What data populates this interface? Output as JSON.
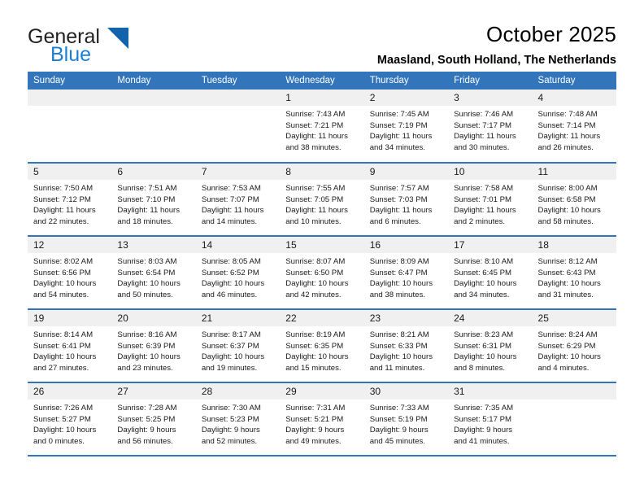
{
  "brand": {
    "name_part1": "General",
    "name_part2": "Blue",
    "triangle_color": "#1164ab",
    "blue_color": "#1b7fd4"
  },
  "header": {
    "title": "October 2025",
    "subtitle": "Maasland, South Holland, The Netherlands"
  },
  "theme": {
    "header_row_bg": "#3275bb",
    "daynum_bg": "#f0f0f0",
    "row_separator": "#3275bb"
  },
  "weekdays": [
    "Sunday",
    "Monday",
    "Tuesday",
    "Wednesday",
    "Thursday",
    "Friday",
    "Saturday"
  ],
  "weeks": [
    [
      {
        "day": "",
        "empty": true
      },
      {
        "day": "",
        "empty": true
      },
      {
        "day": "",
        "empty": true
      },
      {
        "day": "1",
        "sunrise": "Sunrise: 7:43 AM",
        "sunset": "Sunset: 7:21 PM",
        "daylight1": "Daylight: 11 hours",
        "daylight2": "and 38 minutes."
      },
      {
        "day": "2",
        "sunrise": "Sunrise: 7:45 AM",
        "sunset": "Sunset: 7:19 PM",
        "daylight1": "Daylight: 11 hours",
        "daylight2": "and 34 minutes."
      },
      {
        "day": "3",
        "sunrise": "Sunrise: 7:46 AM",
        "sunset": "Sunset: 7:17 PM",
        "daylight1": "Daylight: 11 hours",
        "daylight2": "and 30 minutes."
      },
      {
        "day": "4",
        "sunrise": "Sunrise: 7:48 AM",
        "sunset": "Sunset: 7:14 PM",
        "daylight1": "Daylight: 11 hours",
        "daylight2": "and 26 minutes."
      }
    ],
    [
      {
        "day": "5",
        "sunrise": "Sunrise: 7:50 AM",
        "sunset": "Sunset: 7:12 PM",
        "daylight1": "Daylight: 11 hours",
        "daylight2": "and 22 minutes."
      },
      {
        "day": "6",
        "sunrise": "Sunrise: 7:51 AM",
        "sunset": "Sunset: 7:10 PM",
        "daylight1": "Daylight: 11 hours",
        "daylight2": "and 18 minutes."
      },
      {
        "day": "7",
        "sunrise": "Sunrise: 7:53 AM",
        "sunset": "Sunset: 7:07 PM",
        "daylight1": "Daylight: 11 hours",
        "daylight2": "and 14 minutes."
      },
      {
        "day": "8",
        "sunrise": "Sunrise: 7:55 AM",
        "sunset": "Sunset: 7:05 PM",
        "daylight1": "Daylight: 11 hours",
        "daylight2": "and 10 minutes."
      },
      {
        "day": "9",
        "sunrise": "Sunrise: 7:57 AM",
        "sunset": "Sunset: 7:03 PM",
        "daylight1": "Daylight: 11 hours",
        "daylight2": "and 6 minutes."
      },
      {
        "day": "10",
        "sunrise": "Sunrise: 7:58 AM",
        "sunset": "Sunset: 7:01 PM",
        "daylight1": "Daylight: 11 hours",
        "daylight2": "and 2 minutes."
      },
      {
        "day": "11",
        "sunrise": "Sunrise: 8:00 AM",
        "sunset": "Sunset: 6:58 PM",
        "daylight1": "Daylight: 10 hours",
        "daylight2": "and 58 minutes."
      }
    ],
    [
      {
        "day": "12",
        "sunrise": "Sunrise: 8:02 AM",
        "sunset": "Sunset: 6:56 PM",
        "daylight1": "Daylight: 10 hours",
        "daylight2": "and 54 minutes."
      },
      {
        "day": "13",
        "sunrise": "Sunrise: 8:03 AM",
        "sunset": "Sunset: 6:54 PM",
        "daylight1": "Daylight: 10 hours",
        "daylight2": "and 50 minutes."
      },
      {
        "day": "14",
        "sunrise": "Sunrise: 8:05 AM",
        "sunset": "Sunset: 6:52 PM",
        "daylight1": "Daylight: 10 hours",
        "daylight2": "and 46 minutes."
      },
      {
        "day": "15",
        "sunrise": "Sunrise: 8:07 AM",
        "sunset": "Sunset: 6:50 PM",
        "daylight1": "Daylight: 10 hours",
        "daylight2": "and 42 minutes."
      },
      {
        "day": "16",
        "sunrise": "Sunrise: 8:09 AM",
        "sunset": "Sunset: 6:47 PM",
        "daylight1": "Daylight: 10 hours",
        "daylight2": "and 38 minutes."
      },
      {
        "day": "17",
        "sunrise": "Sunrise: 8:10 AM",
        "sunset": "Sunset: 6:45 PM",
        "daylight1": "Daylight: 10 hours",
        "daylight2": "and 34 minutes."
      },
      {
        "day": "18",
        "sunrise": "Sunrise: 8:12 AM",
        "sunset": "Sunset: 6:43 PM",
        "daylight1": "Daylight: 10 hours",
        "daylight2": "and 31 minutes."
      }
    ],
    [
      {
        "day": "19",
        "sunrise": "Sunrise: 8:14 AM",
        "sunset": "Sunset: 6:41 PM",
        "daylight1": "Daylight: 10 hours",
        "daylight2": "and 27 minutes."
      },
      {
        "day": "20",
        "sunrise": "Sunrise: 8:16 AM",
        "sunset": "Sunset: 6:39 PM",
        "daylight1": "Daylight: 10 hours",
        "daylight2": "and 23 minutes."
      },
      {
        "day": "21",
        "sunrise": "Sunrise: 8:17 AM",
        "sunset": "Sunset: 6:37 PM",
        "daylight1": "Daylight: 10 hours",
        "daylight2": "and 19 minutes."
      },
      {
        "day": "22",
        "sunrise": "Sunrise: 8:19 AM",
        "sunset": "Sunset: 6:35 PM",
        "daylight1": "Daylight: 10 hours",
        "daylight2": "and 15 minutes."
      },
      {
        "day": "23",
        "sunrise": "Sunrise: 8:21 AM",
        "sunset": "Sunset: 6:33 PM",
        "daylight1": "Daylight: 10 hours",
        "daylight2": "and 11 minutes."
      },
      {
        "day": "24",
        "sunrise": "Sunrise: 8:23 AM",
        "sunset": "Sunset: 6:31 PM",
        "daylight1": "Daylight: 10 hours",
        "daylight2": "and 8 minutes."
      },
      {
        "day": "25",
        "sunrise": "Sunrise: 8:24 AM",
        "sunset": "Sunset: 6:29 PM",
        "daylight1": "Daylight: 10 hours",
        "daylight2": "and 4 minutes."
      }
    ],
    [
      {
        "day": "26",
        "sunrise": "Sunrise: 7:26 AM",
        "sunset": "Sunset: 5:27 PM",
        "daylight1": "Daylight: 10 hours",
        "daylight2": "and 0 minutes."
      },
      {
        "day": "27",
        "sunrise": "Sunrise: 7:28 AM",
        "sunset": "Sunset: 5:25 PM",
        "daylight1": "Daylight: 9 hours",
        "daylight2": "and 56 minutes."
      },
      {
        "day": "28",
        "sunrise": "Sunrise: 7:30 AM",
        "sunset": "Sunset: 5:23 PM",
        "daylight1": "Daylight: 9 hours",
        "daylight2": "and 52 minutes."
      },
      {
        "day": "29",
        "sunrise": "Sunrise: 7:31 AM",
        "sunset": "Sunset: 5:21 PM",
        "daylight1": "Daylight: 9 hours",
        "daylight2": "and 49 minutes."
      },
      {
        "day": "30",
        "sunrise": "Sunrise: 7:33 AM",
        "sunset": "Sunset: 5:19 PM",
        "daylight1": "Daylight: 9 hours",
        "daylight2": "and 45 minutes."
      },
      {
        "day": "31",
        "sunrise": "Sunrise: 7:35 AM",
        "sunset": "Sunset: 5:17 PM",
        "daylight1": "Daylight: 9 hours",
        "daylight2": "and 41 minutes."
      },
      {
        "day": "",
        "empty": true
      }
    ]
  ]
}
